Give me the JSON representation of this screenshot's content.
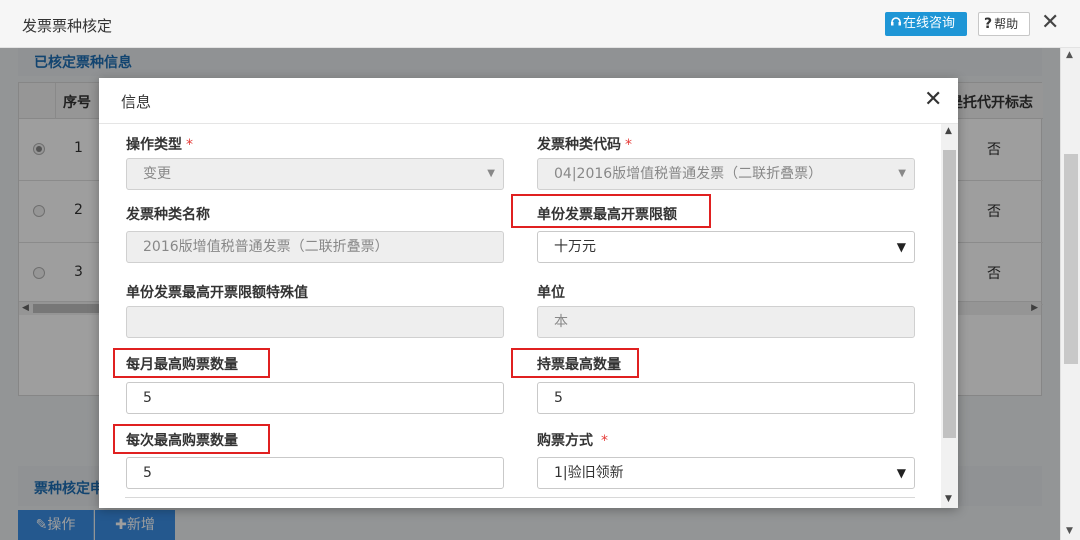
{
  "outer": {
    "title": "发票票种核定",
    "consult_label": "在线咨询",
    "help_label": "帮助",
    "close_label": "✕",
    "section_title": "已核定票种信息",
    "section2_title": "票种核定申",
    "grid": {
      "col_seq": "序号",
      "col_flag": "是托代开标志",
      "rows": [
        {
          "seq": "1",
          "flag": "否"
        },
        {
          "seq": "2",
          "flag": "否"
        },
        {
          "seq": "3",
          "flag": "否"
        }
      ]
    },
    "operate_label": "操作",
    "add_label": "新增"
  },
  "modal": {
    "title": "信息",
    "close_label": "✕",
    "fields": {
      "op_type": {
        "label": "操作类型",
        "value": "变更"
      },
      "invoice_code": {
        "label": "发票种类代码",
        "value": "04|2016版增值税普通发票（二联折叠票）"
      },
      "invoice_name": {
        "label": "发票种类名称",
        "value": "2016版增值税普通发票（二联折叠票）"
      },
      "max_amount": {
        "label": "单份发票最高开票限额",
        "value": "十万元"
      },
      "special_value": {
        "label": "单份发票最高开票限额特殊值",
        "value": ""
      },
      "unit": {
        "label": "单位",
        "value": "本"
      },
      "monthly_max": {
        "label": "每月最高购票数量",
        "value": "5"
      },
      "holding_max": {
        "label": "持票最高数量",
        "value": "5"
      },
      "per_time_max": {
        "label": "每次最高购票数量",
        "value": "5"
      },
      "purchase_method": {
        "label": "购票方式",
        "value": "1|验旧领新"
      }
    },
    "required_mark": "*"
  },
  "colors": {
    "accent": "#1e96d6",
    "section_title": "#1e6fb5",
    "highlight": "#e02020",
    "required": "#e53935"
  }
}
